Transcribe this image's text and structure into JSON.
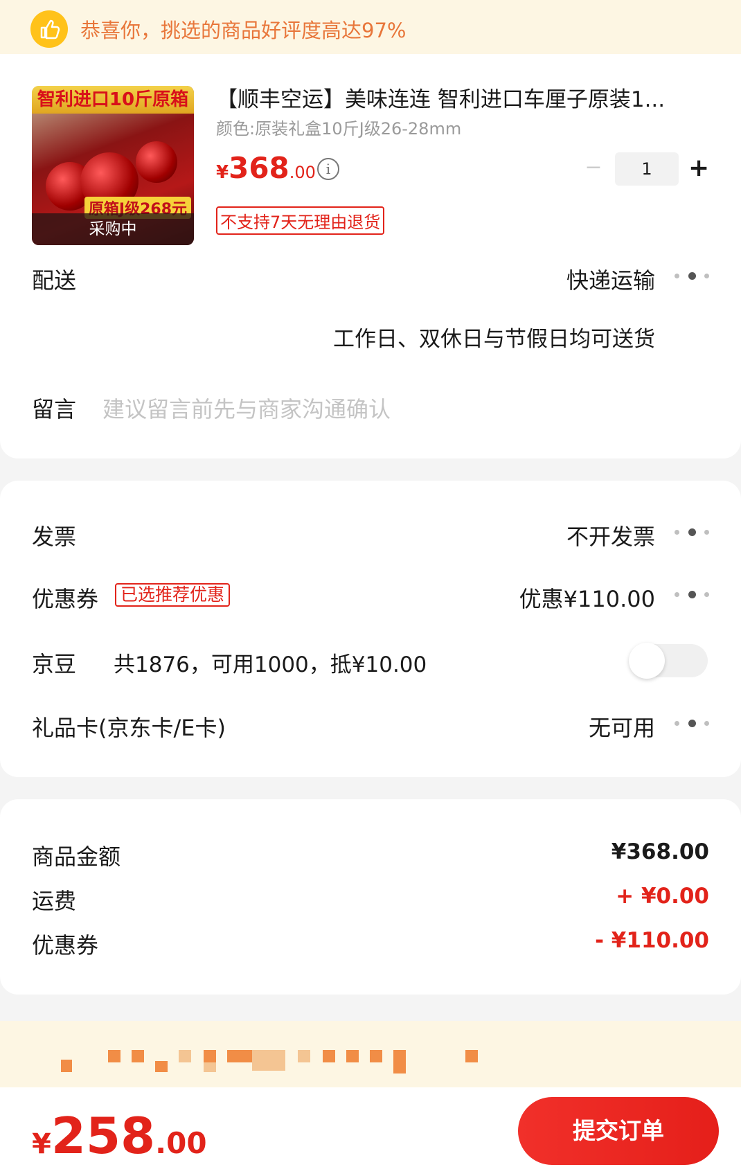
{
  "banner": {
    "text": "恭喜你，挑选的商品好评度高达97%",
    "icon": "thumbs-up-icon"
  },
  "product": {
    "image_header": "智利进口10斤原箱",
    "image_tag": "原箱J级268元",
    "image_status": "采购中",
    "title": "【顺丰空运】美味连连 智利进口车厘子原装1...",
    "spec": "颜色:原装礼盒10斤J级26-28mm",
    "price_symbol": "¥",
    "price_int": "368",
    "price_dec": ".00",
    "quantity": "1",
    "minus_label": "−",
    "plus_label": "+",
    "return_policy": "不支持7天无理由退货"
  },
  "delivery": {
    "label": "配送",
    "method": "快递运输",
    "schedule": "工作日、双休日与节假日均可送货"
  },
  "message": {
    "label": "留言",
    "placeholder": "建议留言前先与商家沟通确认"
  },
  "invoice": {
    "label": "发票",
    "value": "不开发票"
  },
  "coupon": {
    "label": "优惠券",
    "badge": "已选推荐优惠",
    "value": "优惠¥110.00"
  },
  "jd_beans": {
    "label": "京豆",
    "desc": "共1876，可用1000，抵¥10.00",
    "enabled": false
  },
  "gift_card": {
    "label": "礼品卡(京东卡/E卡)",
    "value": "无可用"
  },
  "summary": {
    "goods_label": "商品金额",
    "goods_value": "¥368.00",
    "shipping_label": "运费",
    "shipping_value": "+ ¥0.00",
    "coupon_label": "优惠券",
    "coupon_value": "- ¥110.00"
  },
  "footer": {
    "total_symbol": "¥",
    "total_int": "258",
    "total_dec": ".00",
    "submit_label": "提交订单"
  },
  "colors": {
    "accent": "#e2231a",
    "banner_bg": "#fdf6e3",
    "banner_text": "#e8763a",
    "thumb_icon": "#ffc21a"
  }
}
